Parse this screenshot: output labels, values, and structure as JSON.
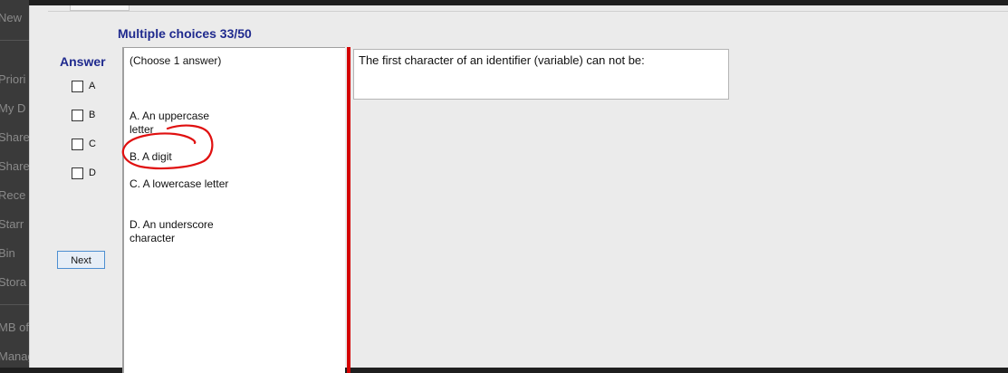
{
  "background_app": {
    "items": [
      "New",
      "Priori",
      "My D",
      "Share",
      "Share",
      "Rece",
      "Starr",
      "Bin",
      "Stora",
      "MB of",
      "Manag"
    ]
  },
  "quiz": {
    "title": "Multiple choices 33/50",
    "answer_label": "Answer",
    "checkboxes": [
      {
        "label": "A",
        "checked": false
      },
      {
        "label": "B",
        "checked": false
      },
      {
        "label": "C",
        "checked": false
      },
      {
        "label": "D",
        "checked": false
      }
    ],
    "next_label": "Next",
    "instruction": "(Choose 1 answer)",
    "options": [
      {
        "text": "A.  An uppercase letter"
      },
      {
        "text": "B.  A digit"
      },
      {
        "text": "C.  A lowercase letter"
      },
      {
        "text": "D.  An underscore character"
      }
    ],
    "question": "The first character of an identifier (variable) can not be:"
  },
  "colors": {
    "title": "#1f2a8e",
    "splitter": "#d40000",
    "annotation": "#e01010",
    "window_bg": "#ebebeb"
  },
  "icons": {
    "annotation": "red-hand-drawn-circle"
  }
}
